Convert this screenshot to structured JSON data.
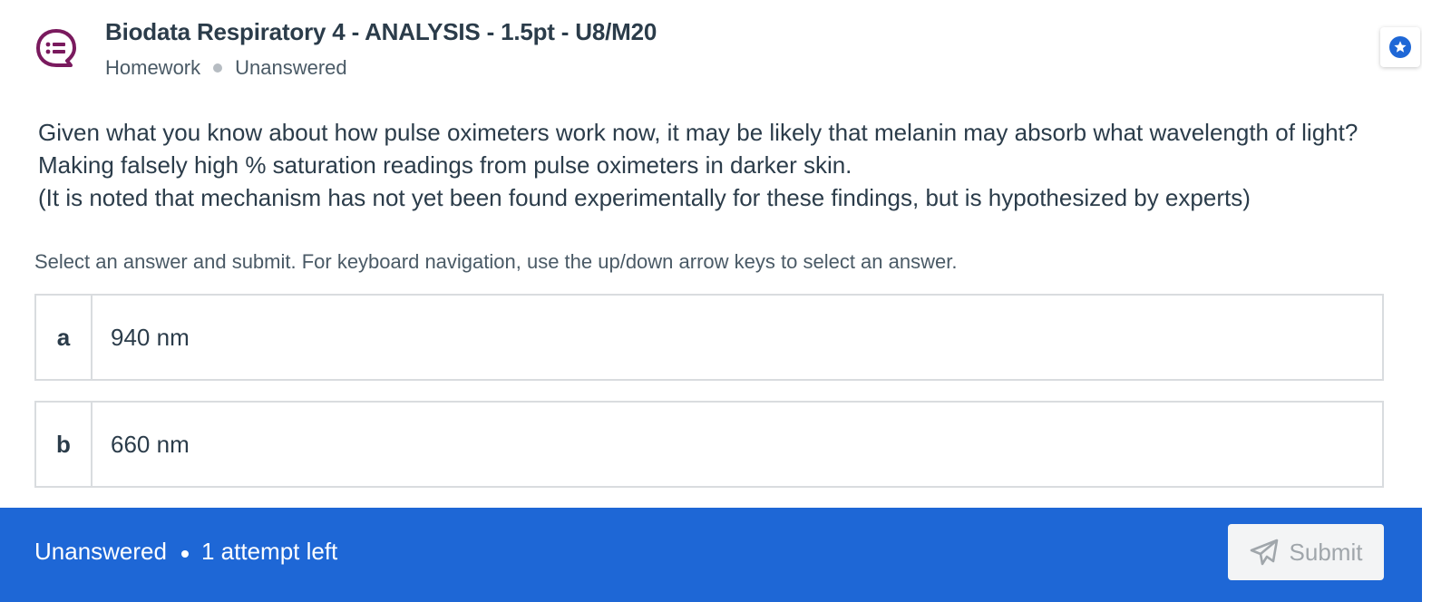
{
  "header": {
    "title": "Biodata Respiratory 4 - ANALYSIS - 1.5pt - U8/M20",
    "type": "Homework",
    "status": "Unanswered",
    "icon": "question-bubble-icon",
    "bookmark_icon": "star-icon"
  },
  "prompt": {
    "lines": [
      "Given what you know about how pulse oximeters work now, it may be likely that melanin may absorb what wavelength of light?",
      "Making falsely high % saturation readings from pulse oximeters in darker skin.",
      "(It is noted that mechanism has not yet been found experimentally for these findings, but is hypothesized by experts)"
    ]
  },
  "instructions": "Select an answer and submit. For keyboard navigation, use the up/down arrow keys to select an answer.",
  "options": [
    {
      "letter": "a",
      "text": "940 nm"
    },
    {
      "letter": "b",
      "text": "660 nm"
    }
  ],
  "footer": {
    "status": "Unanswered",
    "attempts": "1 attempt left",
    "submit_label": "Submit",
    "submit_icon": "paper-plane-icon"
  },
  "colors": {
    "accent": "#1e67d6",
    "icon_purple": "#7a1a5e",
    "star_blue": "#1e67d6"
  }
}
